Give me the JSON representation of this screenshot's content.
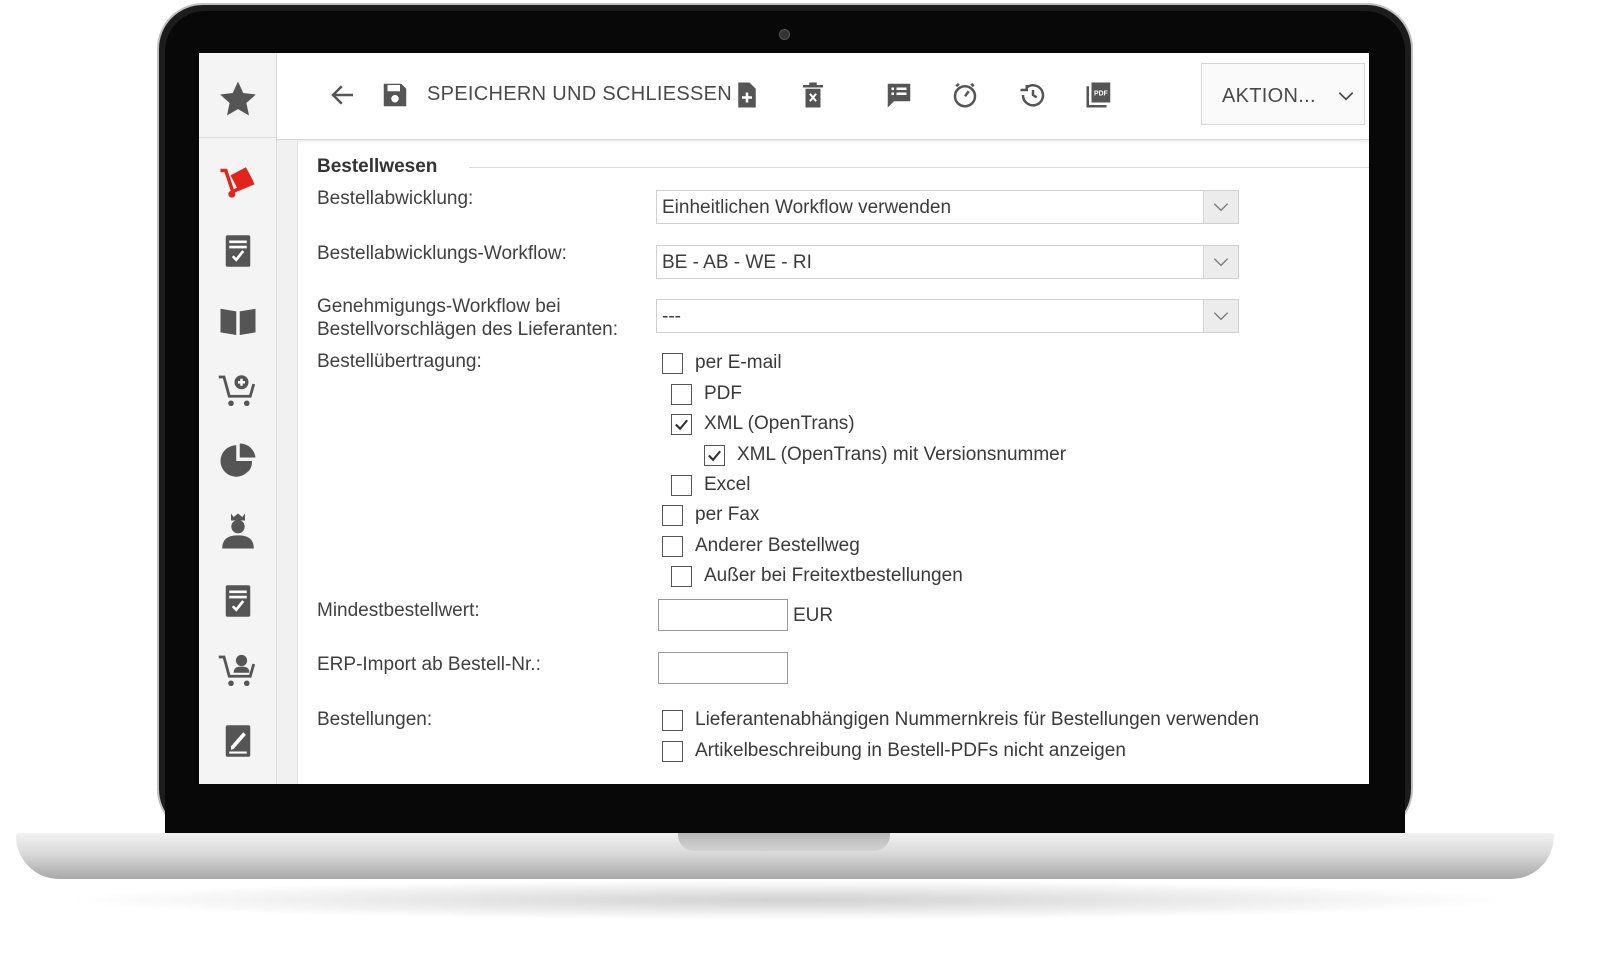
{
  "toolbar": {
    "save_and_close_label": "SPEICHERN UND SCHLIESSEN",
    "action_menu_label": "AKTION..."
  },
  "sidebar": {
    "items": [
      {
        "icon": "star-icon"
      },
      {
        "icon": "hand-truck-icon",
        "active": true
      },
      {
        "icon": "checklist-document-icon"
      },
      {
        "icon": "open-book-icon"
      },
      {
        "icon": "cart-add-icon"
      },
      {
        "icon": "pie-chart-icon"
      },
      {
        "icon": "admin-user-icon"
      },
      {
        "icon": "checklist-document-icon"
      },
      {
        "icon": "cart-user-icon"
      },
      {
        "icon": "edit-document-icon"
      }
    ]
  },
  "form": {
    "section_title": "Bestellwesen",
    "order_processing": {
      "label": "Bestellabwicklung:",
      "value": "Einheitlichen Workflow verwenden"
    },
    "order_workflow": {
      "label": "Bestellabwicklungs-Workflow:",
      "value": "BE - AB - WE - RI"
    },
    "approval_workflow": {
      "label_line1": "Genehmigungs-Workflow bei",
      "label_line2": "Bestellvorschlägen des Lieferanten:",
      "value": "---"
    },
    "transmission": {
      "label": "Bestellübertragung:",
      "options": [
        {
          "label": "per E-mail",
          "checked": false
        },
        {
          "label": "PDF",
          "checked": false
        },
        {
          "label": "XML (OpenTrans)",
          "checked": true
        },
        {
          "label": "XML (OpenTrans) mit Versionsnummer",
          "checked": true
        },
        {
          "label": "Excel",
          "checked": false
        },
        {
          "label": "per Fax",
          "checked": false
        },
        {
          "label": "Anderer Bestellweg",
          "checked": false
        },
        {
          "label": "Außer bei Freitextbestellungen",
          "checked": false
        }
      ]
    },
    "min_order": {
      "label": "Mindestbestellwert:",
      "value": "",
      "unit": "EUR"
    },
    "erp_import": {
      "label": "ERP-Import ab Bestell-Nr.:",
      "value": ""
    },
    "orders": {
      "label": "Bestellungen:",
      "options": [
        {
          "label": "Lieferantenabhängigen Nummernkreis für Bestellungen verwenden",
          "checked": false
        },
        {
          "label": "Artikelbeschreibung in Bestell-PDFs nicht anzeigen",
          "checked": false
        }
      ]
    }
  },
  "colors": {
    "accent": "#e0261c",
    "icon_gray": "#555555"
  }
}
